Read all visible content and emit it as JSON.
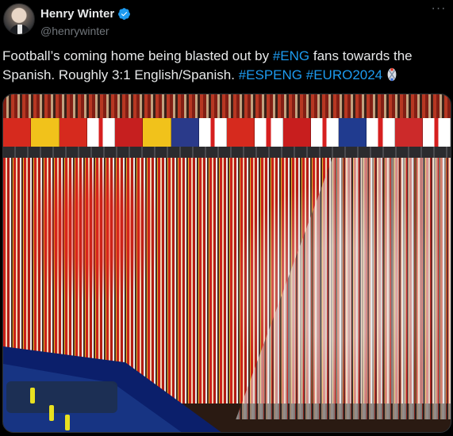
{
  "author": {
    "name": "Henry Winter",
    "handle": "@henrywinter",
    "verified": true,
    "avatar_icon": "avatar"
  },
  "more_menu": {
    "icon": "more-horizontal-icon",
    "label": "···"
  },
  "tweet": {
    "segments": [
      {
        "text": "Football’s coming home being blasted out by ",
        "hashtag": false
      },
      {
        "text": "#ENG",
        "hashtag": true
      },
      {
        "text": " fans towards the Spanish. Roughly 3:1 English/Spanish. ",
        "hashtag": false
      },
      {
        "text": "#ESPENG",
        "hashtag": true
      },
      {
        "text": " ",
        "hashtag": false
      },
      {
        "text": "#EURO2024",
        "hashtag": true
      }
    ],
    "emoji_icon": "euro2024-emoji"
  },
  "colors": {
    "background": "#000000",
    "text": "#e7e9ea",
    "secondary_text": "#71767b",
    "hashtag": "#1d9bf0",
    "verified": "#1d9bf0",
    "border": "#2f3336"
  },
  "media": {
    "type": "photo",
    "banners": [
      "#d62a1e",
      "#f1c21b",
      "#d62a1e",
      "#ffffff",
      "#c61f1f",
      "#f1c21b",
      "#2a3a8a",
      "#ffffff",
      "#d62a1e",
      "#ffffff",
      "#c81e1e",
      "#ffffff",
      "#203b8f",
      "#ffffff",
      "#cc2a2a",
      "#ffffff"
    ]
  }
}
